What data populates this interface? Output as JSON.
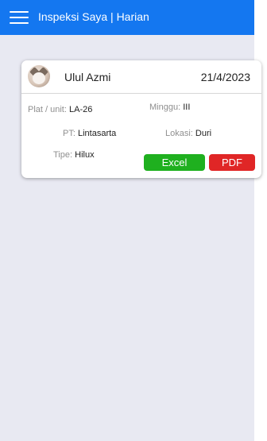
{
  "header": {
    "title": "Inspeksi Saya | Harian",
    "menu_icon": "hamburger-menu-icon",
    "color": "#1477f0"
  },
  "card": {
    "name": "Ulul Azmi",
    "date": "21/4/2023",
    "avatar_icon": "cat-avatar",
    "fields": {
      "plat": {
        "label": "Plat / unit",
        "value": "LA-26"
      },
      "minggu": {
        "label": "Minggu",
        "value": "III"
      },
      "pt": {
        "label": "PT",
        "value": "Lintasarta"
      },
      "lokasi": {
        "label": "Lokasi",
        "value": "Duri"
      },
      "tipe": {
        "label": "Tipe",
        "value": "Hilux"
      }
    },
    "buttons": {
      "excel": {
        "label": "Excel",
        "color": "#1fb01f"
      },
      "pdf": {
        "label": "PDF",
        "color": "#e02626"
      }
    }
  }
}
